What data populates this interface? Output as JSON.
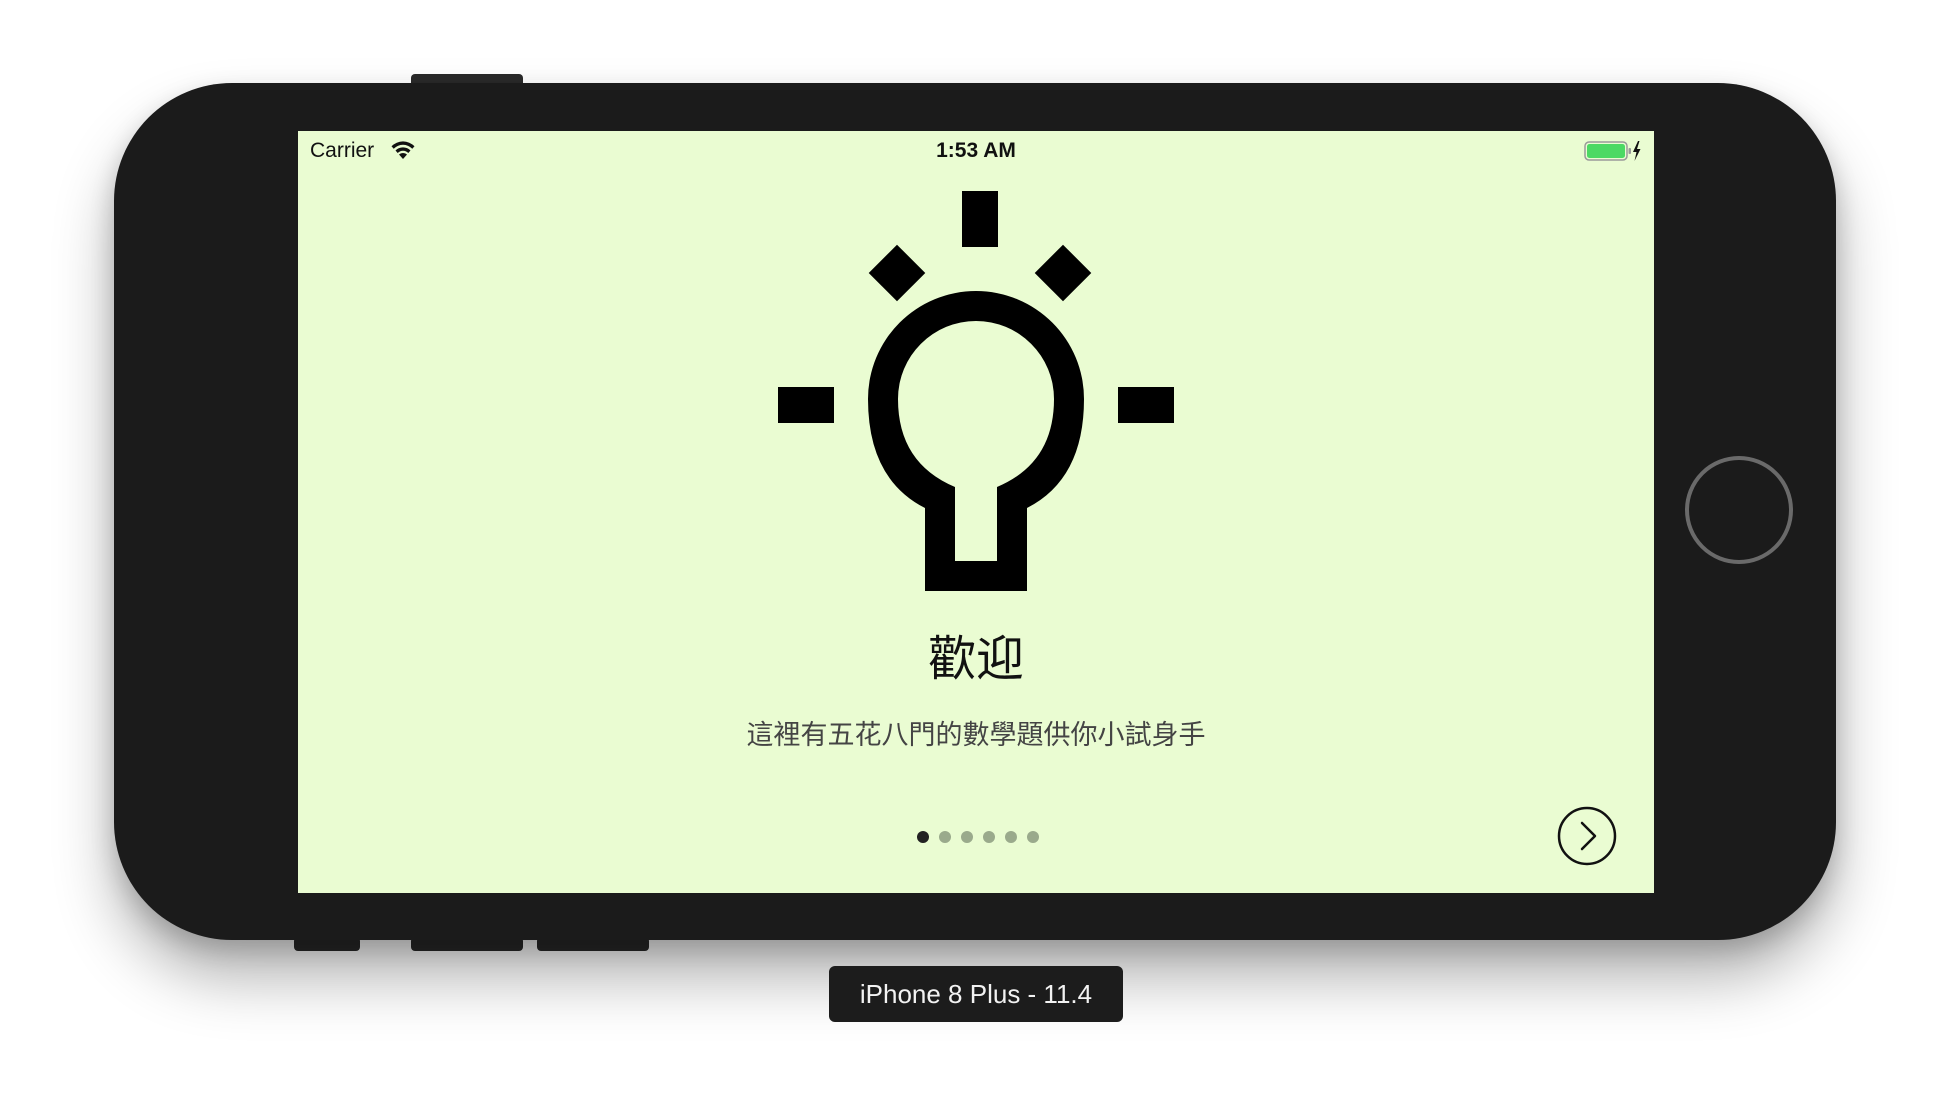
{
  "status_bar": {
    "carrier": "Carrier",
    "time": "1:53 AM",
    "wifi_icon": "wifi-icon",
    "battery_icon": "battery-charging-icon",
    "battery_color": "#4cd964"
  },
  "onboarding": {
    "icon": "lightbulb-icon",
    "title": "歡迎",
    "subtitle": "這裡有五花八門的數學題供你小試身手",
    "background_color": "#eafcd2",
    "page_count": 6,
    "current_page": 1,
    "next_icon": "chevron-right-circle-icon"
  },
  "simulator": {
    "device_label": "iPhone 8 Plus - 11.4"
  }
}
